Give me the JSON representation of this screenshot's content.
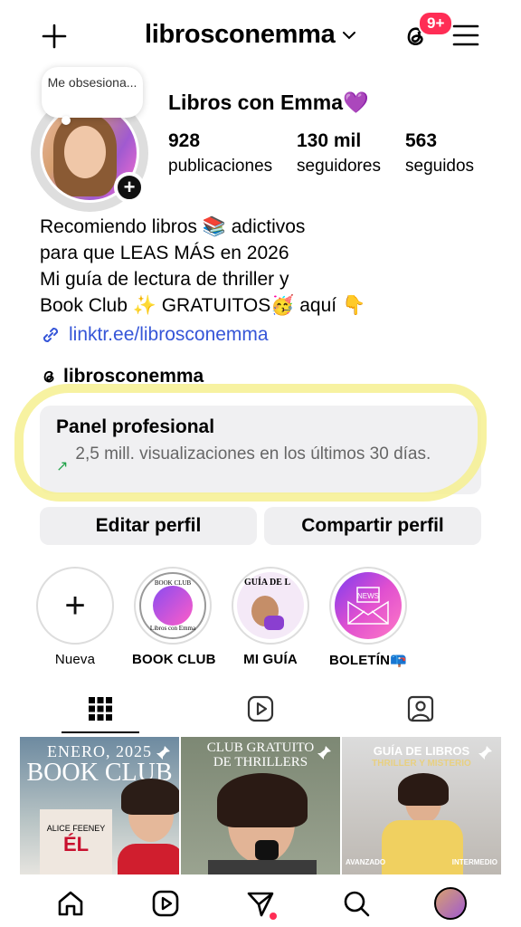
{
  "header": {
    "username": "librosconemma",
    "notification_badge": "9+"
  },
  "profile": {
    "note": "Me obsesiona...",
    "display_name": "Libros con Emma",
    "display_name_emoji": "💜",
    "stats": [
      {
        "value": "928",
        "label": "publicaciones"
      },
      {
        "value": "130 mil",
        "label": "seguidores"
      },
      {
        "value": "563",
        "label": "seguidos"
      }
    ],
    "bio": [
      "Recomiendo libros 📚 adictivos",
      "para que LEAS MÁS en 2026",
      "Mi guía de lectura de thriller y",
      "Book Club ✨ GRATUITOS🥳 aquí 👇"
    ],
    "link": "linktr.ee/librosconemma",
    "threads_handle": "librosconemma"
  },
  "dashboard": {
    "title": "Panel profesional",
    "subtitle": "2,5 mill. visualizaciones en los últimos 30 días."
  },
  "buttons": {
    "edit": "Editar perfil",
    "share": "Compartir perfil"
  },
  "highlights": [
    {
      "label": "Nueva"
    },
    {
      "label": "BOOK CLUB",
      "cover_top": "BOOK CLUB",
      "cover_bottom": "Libros con Emma"
    },
    {
      "label": "MI GUÍA",
      "cover_text": "GUÍA DE L"
    },
    {
      "label": "BOLETÍN📪",
      "cover_text": "NEWS"
    }
  ],
  "posts": [
    {
      "line1": "ENERO, 2025",
      "line2": "BOOK CLUB",
      "book_author": "ALICE FEENEY",
      "book_title": "ÉL"
    },
    {
      "line1": "CLUB GRATUITO",
      "line2": "DE THRILLERS"
    },
    {
      "line1": "GUÍA DE LIBROS",
      "line2": "THRILLER Y MISTERIO",
      "tag_left": "AVANZADO",
      "tag_right": "INTERMEDIO"
    }
  ],
  "colors": {
    "link": "#3656d8",
    "badge": "#ff2d55",
    "highlight_marker": "#f6f090",
    "heart": "#9b3df0"
  }
}
